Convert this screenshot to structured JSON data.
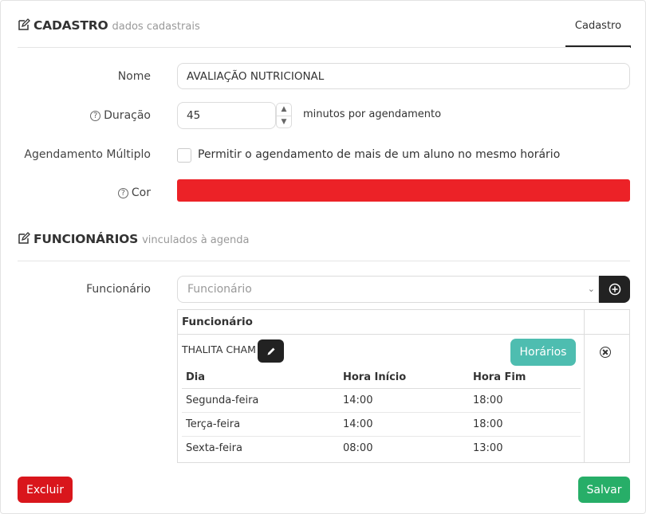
{
  "cadastro": {
    "title": "CADASTRO",
    "subtitle": "dados cadastrais",
    "tab": "Cadastro"
  },
  "form": {
    "nome_label": "Nome",
    "nome_value": "AVALIAÇÃO NUTRICIONAL",
    "duracao_label": "Duração",
    "duracao_value": "45",
    "duracao_suffix": "minutos por agendamento",
    "multiplo_label": "Agendamento Múltiplo",
    "multiplo_text": "Permitir o agendamento de mais de um aluno no mesmo horário",
    "multiplo_checked": false,
    "cor_label": "Cor",
    "cor_value": "#ec2227"
  },
  "funcionarios": {
    "title": "FUNCIONÁRIOS",
    "subtitle": "vinculados à agenda",
    "select_label": "Funcionário",
    "select_placeholder": "Funcionário",
    "table_header": "Funcionário",
    "employee_name": "THALITA CHAM",
    "horarios_button": "Horários",
    "schedule_headers": [
      "Dia",
      "Hora Início",
      "Hora Fim"
    ],
    "schedule": [
      [
        "Segunda-feira",
        "14:00",
        "18:00"
      ],
      [
        "Terça-feira",
        "14:00",
        "18:00"
      ],
      [
        "Sexta-feira",
        "08:00",
        "13:00"
      ]
    ]
  },
  "actions": {
    "delete": "Excluir",
    "save": "Salvar"
  },
  "colors": {
    "delete": "#d9161c",
    "save": "#27ae68",
    "horarios": "#4ebdb0",
    "dark_button": "#222222"
  },
  "icons": [
    "edit-icon",
    "question-icon",
    "plus-circle-icon",
    "pencil-icon",
    "x-circle-icon",
    "chevron-down-icon"
  ]
}
